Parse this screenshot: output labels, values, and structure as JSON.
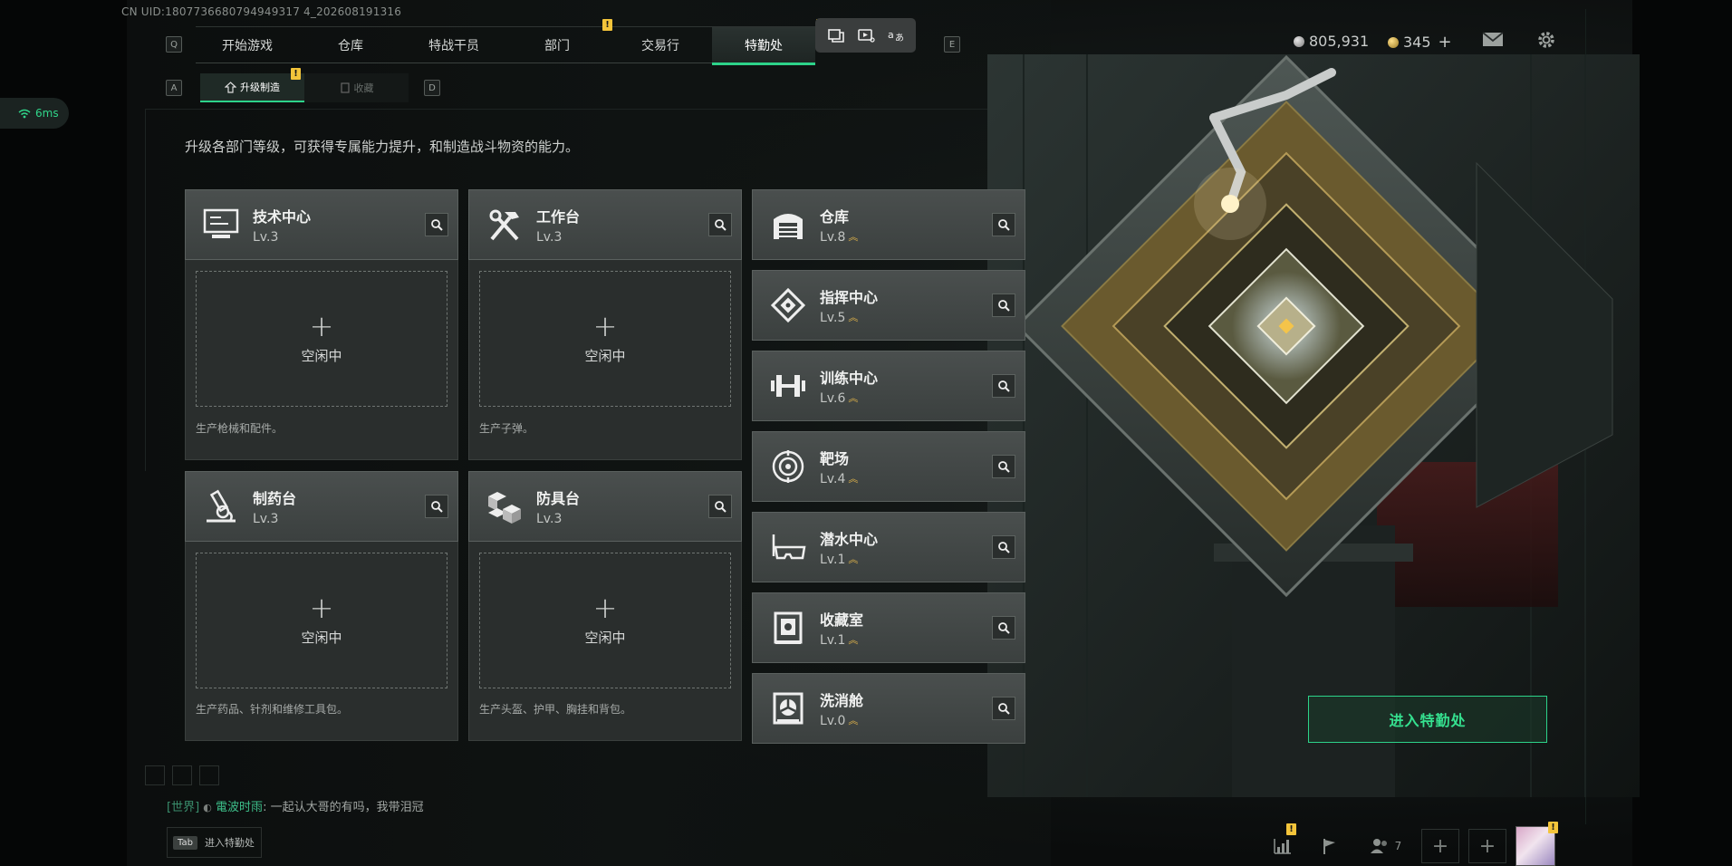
{
  "uid": "CN UID:1807736680794949317 4_202608191316",
  "keys": {
    "prev_tab": "Q",
    "next_tab": "E",
    "prev_sub": "A",
    "next_sub": "D"
  },
  "tabs": [
    {
      "label": "开始游戏",
      "warn": false
    },
    {
      "label": "仓库",
      "warn": false
    },
    {
      "label": "特战干员",
      "warn": false
    },
    {
      "label": "部门",
      "warn": true
    },
    {
      "label": "交易行",
      "warn": false
    },
    {
      "label": "特勤处",
      "warn": true,
      "active": true
    }
  ],
  "warn_mark": "!",
  "currency": {
    "silver": "805,931",
    "gold": "345",
    "add": "+"
  },
  "subtabs": {
    "upgrade": "升级制造",
    "collection": "收藏"
  },
  "ping": "6ms",
  "description": "升级各部门等级，可获得专属能力提升，和制造战斗物资的能力。",
  "production": [
    {
      "name": "技术中心",
      "level": "Lv.3",
      "icon": "computer-icon",
      "slot": "空闲中",
      "desc": "生产枪械和配件。"
    },
    {
      "name": "工作台",
      "level": "Lv.3",
      "icon": "tools-icon",
      "slot": "空闲中",
      "desc": "生产子弹。"
    },
    {
      "name": "制药台",
      "level": "Lv.3",
      "icon": "microscope-icon",
      "slot": "空闲中",
      "desc": "生产药品、针剂和维修工具包。"
    },
    {
      "name": "防具台",
      "level": "Lv.3",
      "icon": "blocks-icon",
      "slot": "空闲中",
      "desc": "生产头盔、护甲、胸挂和背包。"
    }
  ],
  "facilities": [
    {
      "name": "仓库",
      "level": "Lv.8",
      "icon": "garage-icon"
    },
    {
      "name": "指挥中心",
      "level": "Lv.5",
      "icon": "command-icon"
    },
    {
      "name": "训练中心",
      "level": "Lv.6",
      "icon": "dumbbell-icon"
    },
    {
      "name": "靶场",
      "level": "Lv.4",
      "icon": "target-icon"
    },
    {
      "name": "潜水中心",
      "level": "Lv.1",
      "icon": "diving-mask-icon"
    },
    {
      "name": "收藏室",
      "level": "Lv.1",
      "icon": "collection-icon"
    },
    {
      "name": "洗消舱",
      "level": "Lv.0",
      "icon": "decon-icon"
    }
  ],
  "plus_glyph": "+",
  "enter_button": "进入特勤处",
  "chat": {
    "channel": "[世界]",
    "sender": "電波时雨",
    "message": ": 一起认大哥的有吗，我带泪冠"
  },
  "tab_hint": {
    "key": "Tab",
    "label": "进入特勤处"
  },
  "friends_count": "7",
  "colors": {
    "accent": "#2dd38a",
    "warning": "#f3c43a",
    "upgrade_arrow": "#e8b94a"
  }
}
